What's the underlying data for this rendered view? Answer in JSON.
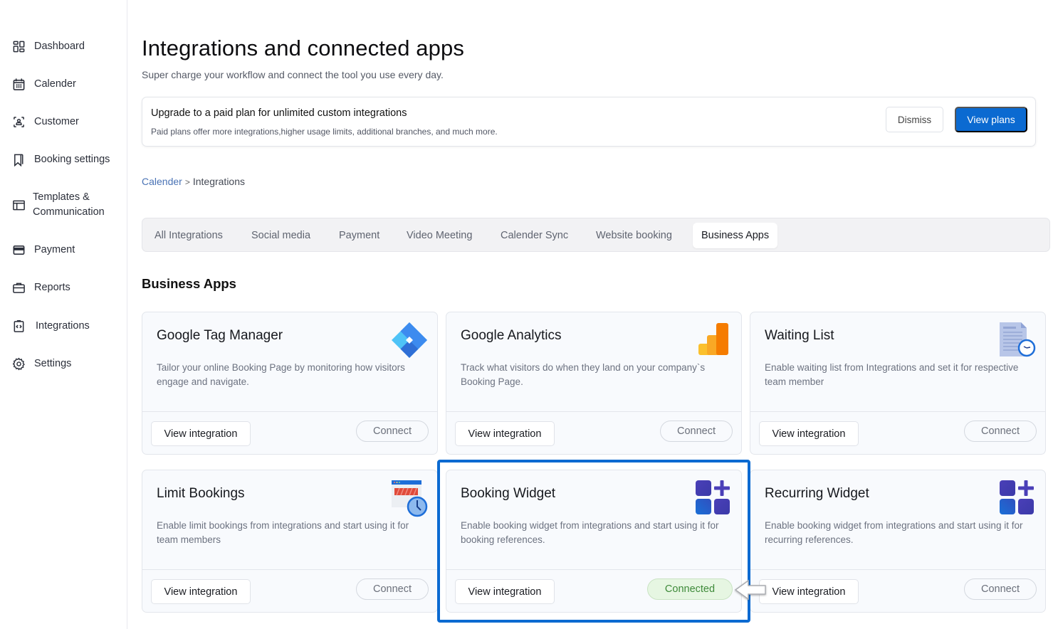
{
  "sidebar": {
    "items": [
      {
        "label": "Dashboard",
        "icon": "dashboard-grid-icon"
      },
      {
        "label": "Calender",
        "icon": "calendar-icon"
      },
      {
        "label": "Customer",
        "icon": "customer-scan-icon"
      },
      {
        "label": "Booking settings",
        "icon": "bookmark-icon"
      },
      {
        "label": "Templates &",
        "label2": "Communication",
        "icon": "template-layout-icon"
      },
      {
        "label": "Payment",
        "icon": "credit-card-icon"
      },
      {
        "label": "Reports",
        "icon": "briefcase-icon"
      },
      {
        "label": "Integrations",
        "icon": "code-clipboard-icon"
      },
      {
        "label": "Settings",
        "icon": "gear-icon"
      }
    ]
  },
  "header": {
    "title": "Integrations and connected apps",
    "subtitle": "Super charge your workflow and connect the tool you use every day."
  },
  "upgrade_banner": {
    "title": "Upgrade to a paid plan for unlimited custom integrations",
    "description": "Paid plans offer more integrations,higher usage limits, additional branches, and much more.",
    "dismiss_label": "Dismiss",
    "view_plans_label": "View plans"
  },
  "breadcrumb": {
    "parent": "Calender",
    "separator": ">",
    "current": "Integrations"
  },
  "tabs": [
    {
      "label": "All Integrations",
      "active": false
    },
    {
      "label": "Social media",
      "active": false
    },
    {
      "label": "Payment",
      "active": false
    },
    {
      "label": "Video Meeting",
      "active": false
    },
    {
      "label": "Calender Sync",
      "active": false
    },
    {
      "label": "Website booking",
      "active": false
    },
    {
      "label": "Business Apps",
      "active": true
    }
  ],
  "section_title": "Business Apps",
  "cards": [
    {
      "title": "Google Tag Manager",
      "description": "Tailor your online Booking Page by monitoring how visitors engage and navigate.",
      "icon": "google-tag-manager-icon",
      "view_label": "View integration",
      "status_label": "Connect",
      "connected": false
    },
    {
      "title": "Google Analytics",
      "description": "Track what visitors do when they land on your company`s Booking Page.",
      "icon": "google-analytics-icon",
      "view_label": "View integration",
      "status_label": "Connect",
      "connected": false
    },
    {
      "title": "Waiting List",
      "description": "Enable waiting list from Integrations and set it for respective team member",
      "icon": "document-clock-icon",
      "view_label": "View integration",
      "status_label": "Connect",
      "connected": false
    },
    {
      "title": "Limit Bookings",
      "description": "Enable limit bookings from integrations and start using it for team members",
      "icon": "window-clock-icon",
      "view_label": "View integration",
      "status_label": "Connect",
      "connected": false
    },
    {
      "title": "Booking Widget",
      "description": "Enable booking widget from integrations and start using it for booking references.",
      "icon": "widget-add-icon",
      "view_label": "View integration",
      "status_label": "Connected",
      "connected": true
    },
    {
      "title": "Recurring Widget",
      "description": "Enable booking widget from integrations and start using it for recurring references.",
      "icon": "widget-add-icon",
      "view_label": "View integration",
      "status_label": "Connect",
      "connected": false
    }
  ],
  "colors": {
    "primary": "#0b6ad1",
    "connected_bg": "#e6f6e2",
    "connected_text": "#3e8a3a",
    "breadcrumb_link": "#4a73b5"
  }
}
